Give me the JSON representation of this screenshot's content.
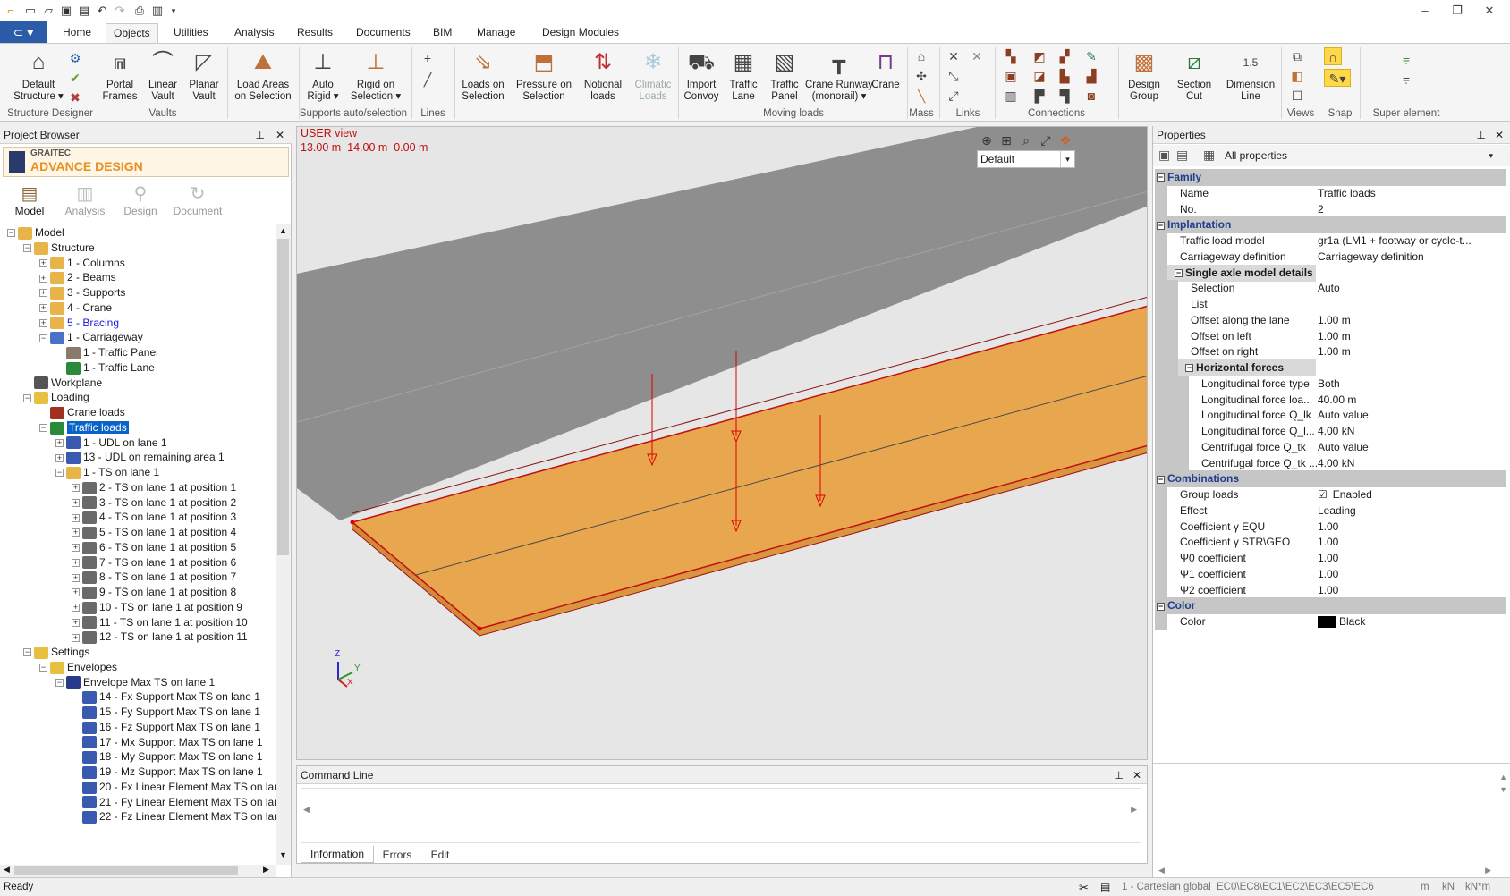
{
  "titlebar": {
    "quick_access": [
      "new-icon",
      "open-icon",
      "save-icon",
      "save-as-icon",
      "undo-icon",
      "redo-icon",
      "print-icon",
      "export-icon",
      "dropdown-icon"
    ],
    "window_controls": [
      "minimize-icon",
      "restore-icon",
      "close-icon"
    ]
  },
  "ribbon_tabs": [
    {
      "label": "Home",
      "active": false
    },
    {
      "label": "Objects",
      "active": true
    },
    {
      "label": "Utilities",
      "active": false
    },
    {
      "label": "Analysis",
      "active": false
    },
    {
      "label": "Results",
      "active": false
    },
    {
      "label": "Documents",
      "active": false
    },
    {
      "label": "BIM",
      "active": false
    },
    {
      "label": "Manage",
      "active": false
    },
    {
      "label": "Design Modules",
      "active": false
    }
  ],
  "ribbon": {
    "buttons": [
      {
        "name": "default-structure-button",
        "l1": "Default",
        "l2": "Structure ▾",
        "icon": "house-icon"
      },
      {
        "name": "portal-frames-button",
        "l1": "Portal",
        "l2": "Frames",
        "icon": "portal-icon"
      },
      {
        "name": "linear-vault-button",
        "l1": "Linear",
        "l2": "Vault",
        "icon": "vault-icon"
      },
      {
        "name": "planar-vault-button",
        "l1": "Planar",
        "l2": "Vault",
        "icon": "planar-vault-icon"
      },
      {
        "name": "load-areas-button",
        "l1": "Load Areas",
        "l2": "on Selection",
        "icon": "load-area-icon"
      },
      {
        "name": "auto-rigid-button",
        "l1": "Auto",
        "l2": "Rigid ▾",
        "icon": "auto-rigid-icon"
      },
      {
        "name": "rigid-on-selection-button",
        "l1": "Rigid on",
        "l2": "Selection ▾",
        "icon": "rigid-icon"
      },
      {
        "name": "loads-on-selection-button",
        "l1": "Loads on",
        "l2": "Selection",
        "icon": "load-arrow-icon"
      },
      {
        "name": "pressure-on-selection-button",
        "l1": "Pressure on",
        "l2": "Selection",
        "icon": "pressure-icon"
      },
      {
        "name": "notional-loads-button",
        "l1": "Notional",
        "l2": "loads",
        "icon": "notional-icon"
      },
      {
        "name": "climatic-loads-button",
        "l1": "Climatic",
        "l2": "Loads",
        "icon": "snowflake-icon",
        "dim": true
      },
      {
        "name": "import-convoy-button",
        "l1": "Import",
        "l2": "Convoy",
        "icon": "truck-icon"
      },
      {
        "name": "traffic-lane-button",
        "l1": "Traffic",
        "l2": "Lane",
        "icon": "lane-icon"
      },
      {
        "name": "traffic-panel-button",
        "l1": "Traffic",
        "l2": "Panel",
        "icon": "panel-icon"
      },
      {
        "name": "crane-runway-button",
        "l1": "Crane Runway",
        "l2": "(monorail) ▾",
        "icon": "runway-icon"
      },
      {
        "name": "crane-button",
        "l1": "Crane",
        "l2": "",
        "icon": "crane-icon"
      },
      {
        "name": "design-group-button",
        "l1": "Design",
        "l2": "Group",
        "icon": "design-group-icon"
      },
      {
        "name": "section-cut-button",
        "l1": "Section",
        "l2": "Cut",
        "icon": "section-cut-icon"
      },
      {
        "name": "dimension-line-button",
        "l1": "Dimension",
        "l2": "Line",
        "icon": "dimension-icon"
      }
    ],
    "dimension_value": "1.5",
    "groups": [
      "Structure Designer",
      "Vaults",
      "Supports auto/selection",
      "Lines",
      "Moving loads",
      "Mass",
      "Links",
      "Connections",
      "Views",
      "Snap",
      "Super element"
    ]
  },
  "project_browser": {
    "title": "Project Browser",
    "brand_top": "GRAITEC",
    "brand_main": "ADVANCE DESIGN",
    "modes": [
      {
        "label": "Model",
        "active": true,
        "icon": "model-icon"
      },
      {
        "label": "Analysis",
        "active": false,
        "icon": "analysis-icon"
      },
      {
        "label": "Design",
        "active": false,
        "icon": "design-icon"
      },
      {
        "label": "Document",
        "active": false,
        "icon": "document-icon"
      }
    ],
    "tree": [
      {
        "label": "Model",
        "level": 0,
        "exp": "−",
        "icon": "folder"
      },
      {
        "label": "Structure",
        "level": 1,
        "exp": "−",
        "icon": "folder"
      },
      {
        "label": "1 - Columns",
        "level": 2,
        "exp": "+",
        "icon": "folder"
      },
      {
        "label": "2 - Beams",
        "level": 2,
        "exp": "+",
        "icon": "folder"
      },
      {
        "label": "3 - Supports",
        "level": 2,
        "exp": "+",
        "icon": "folder"
      },
      {
        "label": "4 - Crane",
        "level": 2,
        "exp": "+",
        "icon": "folder"
      },
      {
        "label": "5 - Bracing",
        "level": 2,
        "exp": "+",
        "icon": "folder",
        "blue": true
      },
      {
        "label": "1 - Carriageway",
        "level": 2,
        "exp": "−",
        "icon": "carriageway"
      },
      {
        "label": "1 - Traffic Panel",
        "level": 3,
        "exp": "",
        "icon": "panel"
      },
      {
        "label": "1 - Traffic Lane",
        "level": 3,
        "exp": "",
        "icon": "lane"
      },
      {
        "label": "Workplane",
        "level": 1,
        "exp": "",
        "icon": "grid"
      },
      {
        "label": "Loading",
        "level": 1,
        "exp": "−",
        "icon": "loading"
      },
      {
        "label": "Crane loads",
        "level": 2,
        "exp": "",
        "icon": "crane"
      },
      {
        "label": "Traffic loads",
        "level": 2,
        "exp": "−",
        "icon": "traffic",
        "sel": true
      },
      {
        "label": "1 - UDL on lane 1",
        "level": 3,
        "exp": "+",
        "icon": "load"
      },
      {
        "label": "13 - UDL on remaining area 1",
        "level": 3,
        "exp": "+",
        "icon": "load"
      },
      {
        "label": "1 - TS on lane 1",
        "level": 3,
        "exp": "−",
        "icon": "openfolder"
      },
      {
        "label": "2 - TS on lane 1 at position 1",
        "level": 4,
        "exp": "+",
        "icon": "ts"
      },
      {
        "label": "3 - TS on lane 1 at position 2",
        "level": 4,
        "exp": "+",
        "icon": "ts"
      },
      {
        "label": "4 - TS on lane 1 at position 3",
        "level": 4,
        "exp": "+",
        "icon": "ts"
      },
      {
        "label": "5 - TS on lane 1 at position 4",
        "level": 4,
        "exp": "+",
        "icon": "ts"
      },
      {
        "label": "6 - TS on lane 1 at position 5",
        "level": 4,
        "exp": "+",
        "icon": "ts"
      },
      {
        "label": "7 - TS on lane 1 at position 6",
        "level": 4,
        "exp": "+",
        "icon": "ts"
      },
      {
        "label": "8 - TS on lane 1 at position 7",
        "level": 4,
        "exp": "+",
        "icon": "ts"
      },
      {
        "label": "9 - TS on lane 1 at position 8",
        "level": 4,
        "exp": "+",
        "icon": "ts"
      },
      {
        "label": "10 - TS on lane 1 at position 9",
        "level": 4,
        "exp": "+",
        "icon": "ts"
      },
      {
        "label": "11 - TS on lane 1 at position 10",
        "level": 4,
        "exp": "+",
        "icon": "ts"
      },
      {
        "label": "12 - TS on lane 1 at position 11",
        "level": 4,
        "exp": "+",
        "icon": "ts"
      },
      {
        "label": "Settings",
        "level": 1,
        "exp": "−",
        "icon": "loading"
      },
      {
        "label": "Envelopes",
        "level": 2,
        "exp": "−",
        "icon": "loading"
      },
      {
        "label": "Envelope Max TS on lane 1",
        "level": 3,
        "exp": "−",
        "icon": "envelope"
      },
      {
        "label": "14 - Fx Support Max TS on lane 1",
        "level": 4,
        "exp": "",
        "icon": "load"
      },
      {
        "label": "15 - Fy Support Max TS on lane 1",
        "level": 4,
        "exp": "",
        "icon": "load"
      },
      {
        "label": "16 - Fz Support Max TS on lane 1",
        "level": 4,
        "exp": "",
        "icon": "load"
      },
      {
        "label": "17 - Mx Support Max TS on lane 1",
        "level": 4,
        "exp": "",
        "icon": "load"
      },
      {
        "label": "18 - My Support Max TS on lane 1",
        "level": 4,
        "exp": "",
        "icon": "load"
      },
      {
        "label": "19 - Mz Support Max TS on lane 1",
        "level": 4,
        "exp": "",
        "icon": "load"
      },
      {
        "label": "20 - Fx Linear Element Max TS on lar",
        "level": 4,
        "exp": "",
        "icon": "load"
      },
      {
        "label": "21 - Fy Linear Element Max TS on lar",
        "level": 4,
        "exp": "",
        "icon": "load"
      },
      {
        "label": "22 - Fz Linear Element Max TS on lar",
        "level": 4,
        "exp": "",
        "icon": "load"
      }
    ]
  },
  "viewport": {
    "view_name": "USER view",
    "coords": "13.00 m  14.00 m  0.00 m",
    "view_select": "Default",
    "toolbar_icons": [
      "zoom-in-icon",
      "zoom-window-icon",
      "zoom-icon",
      "zoom-fit-icon",
      "orbit-icon"
    ],
    "axes": [
      "Z",
      "Y",
      "X"
    ]
  },
  "command_line": {
    "title": "Command Line",
    "tabs": [
      {
        "label": "Information",
        "active": true
      },
      {
        "label": "Errors",
        "active": false
      },
      {
        "label": "Edit",
        "active": false
      }
    ]
  },
  "properties": {
    "title": "Properties",
    "filter": "All properties",
    "rows": [
      {
        "kind": "cat",
        "name": "Family",
        "value": "",
        "level": 0
      },
      {
        "kind": "prop",
        "name": "Name",
        "value": "Traffic loads",
        "level": 1
      },
      {
        "kind": "prop",
        "name": "No.",
        "value": "2",
        "level": 1
      },
      {
        "kind": "cat",
        "name": "Implantation",
        "value": "",
        "level": 0
      },
      {
        "kind": "prop",
        "name": "Traffic load model",
        "value": "gr1a (LM1 + footway or cycle-t...",
        "level": 1
      },
      {
        "kind": "prop",
        "name": "Carriageway definition",
        "value": "Carriageway definition",
        "level": 1
      },
      {
        "kind": "sub",
        "name": "Single axle model details",
        "value": "",
        "level": 1
      },
      {
        "kind": "prop",
        "name": "Selection",
        "value": "Auto",
        "level": 2
      },
      {
        "kind": "prop",
        "name": "List",
        "value": "",
        "level": 2
      },
      {
        "kind": "prop",
        "name": "Offset along the lane",
        "value": "1.00 m",
        "level": 2
      },
      {
        "kind": "prop",
        "name": "Offset on left",
        "value": "1.00 m",
        "level": 2
      },
      {
        "kind": "prop",
        "name": "Offset on right",
        "value": "1.00 m",
        "level": 2
      },
      {
        "kind": "sub",
        "name": "Horizontal forces",
        "value": "",
        "level": 2
      },
      {
        "kind": "prop",
        "name": "Longitudinal force type",
        "value": "Both",
        "level": 3
      },
      {
        "kind": "prop",
        "name": "Longitudinal force loa...",
        "value": "40.00 m",
        "level": 3
      },
      {
        "kind": "prop",
        "name": "Longitudinal force Q_lk",
        "value": "Auto value",
        "level": 3
      },
      {
        "kind": "prop",
        "name": "Longitudinal force Q_l...",
        "value": "4.00 kN",
        "level": 3
      },
      {
        "kind": "prop",
        "name": "Centrifugal force Q_tk",
        "value": "Auto value",
        "level": 3
      },
      {
        "kind": "prop",
        "name": "Centrifugal force Q_tk ...",
        "value": "4.00 kN",
        "level": 3
      },
      {
        "kind": "cat",
        "name": "Combinations",
        "value": "",
        "level": 0
      },
      {
        "kind": "prop",
        "name": "Group loads",
        "value": "Enabled",
        "level": 1,
        "check": true
      },
      {
        "kind": "prop",
        "name": "Effect",
        "value": "Leading",
        "level": 1
      },
      {
        "kind": "prop",
        "name": "Coefficient γ EQU",
        "value": "1.00",
        "level": 1
      },
      {
        "kind": "prop",
        "name": "Coefficient γ STR\\GEO",
        "value": "1.00",
        "level": 1
      },
      {
        "kind": "prop",
        "name": "Ψ0 coefficient",
        "value": "1.00",
        "level": 1
      },
      {
        "kind": "prop",
        "name": "Ψ1 coefficient",
        "value": "1.00",
        "level": 1
      },
      {
        "kind": "prop",
        "name": "Ψ2 coefficient",
        "value": "1.00",
        "level": 1
      },
      {
        "kind": "cat",
        "name": "Color",
        "value": "",
        "level": 0
      },
      {
        "kind": "prop",
        "name": "Color",
        "value": "Black",
        "level": 1,
        "swatch": "#000000"
      }
    ]
  },
  "statusbar": {
    "left": "Ready",
    "coord_system": "1 - Cartesian global",
    "codes": "EC0\\EC8\\EC1\\EC2\\EC3\\EC5\\EC6",
    "units": [
      "m",
      "kN",
      "kN*m"
    ]
  },
  "colors": {
    "deck": "#e8a64e",
    "load": "#e00000",
    "accent": "#2a5ca8",
    "selection": "#0a64c8"
  }
}
